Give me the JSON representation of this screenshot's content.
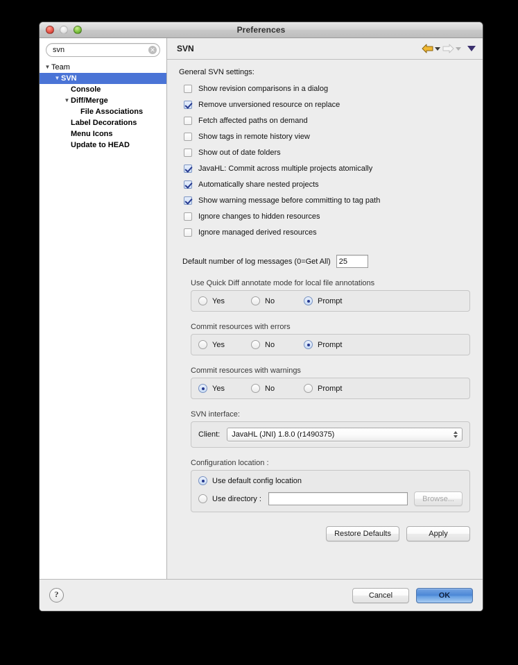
{
  "window": {
    "title": "Preferences",
    "traffic_lights": [
      "close",
      "minimize",
      "maximize"
    ]
  },
  "sidebar": {
    "search": {
      "value": "svn",
      "placeholder": "",
      "clear_glyph": "✕"
    },
    "tree": [
      {
        "label": "Team",
        "depth": 0,
        "twisty": "▼",
        "selected": false
      },
      {
        "label": "SVN",
        "depth": 1,
        "twisty": "▼",
        "selected": true
      },
      {
        "label": "Console",
        "depth": 2,
        "twisty": "",
        "selected": false
      },
      {
        "label": "Diff/Merge",
        "depth": 2,
        "twisty": "▼",
        "selected": false
      },
      {
        "label": "File Associations",
        "depth": 3,
        "twisty": "",
        "selected": false
      },
      {
        "label": "Label Decorations",
        "depth": 2,
        "twisty": "",
        "selected": false
      },
      {
        "label": "Menu Icons",
        "depth": 2,
        "twisty": "",
        "selected": false
      },
      {
        "label": "Update to HEAD",
        "depth": 2,
        "twisty": "",
        "selected": false
      }
    ]
  },
  "page": {
    "title": "SVN",
    "nav": {
      "back_enabled": true,
      "forward_enabled": false,
      "menu_glyph": "▼"
    },
    "section_label": "General SVN settings:",
    "checkboxes": [
      {
        "label": "Show revision comparisons in a dialog",
        "checked": false
      },
      {
        "label": "Remove unversioned resource on replace",
        "checked": true
      },
      {
        "label": "Fetch affected paths on demand",
        "checked": false
      },
      {
        "label": "Show tags in remote history view",
        "checked": false
      },
      {
        "label": "Show out of date folders",
        "checked": false
      },
      {
        "label": "JavaHL: Commit across multiple projects atomically",
        "checked": true
      },
      {
        "label": "Automatically share nested projects",
        "checked": true
      },
      {
        "label": "Show warning message before committing to tag path",
        "checked": true
      },
      {
        "label": "Ignore changes to hidden resources",
        "checked": false
      },
      {
        "label": "Ignore managed derived resources",
        "checked": false
      }
    ],
    "log_messages": {
      "label": "Default number of log messages (0=Get All)",
      "value": "25"
    },
    "radio_groups": [
      {
        "title": "Use Quick Diff annotate mode for local file annotations",
        "options": [
          "Yes",
          "No",
          "Prompt"
        ],
        "selected": "Prompt"
      },
      {
        "title": "Commit resources with errors",
        "options": [
          "Yes",
          "No",
          "Prompt"
        ],
        "selected": "Prompt"
      },
      {
        "title": "Commit resources with warnings",
        "options": [
          "Yes",
          "No",
          "Prompt"
        ],
        "selected": "Yes"
      }
    ],
    "svn_interface": {
      "title": "SVN interface:",
      "client_label": "Client:",
      "client_value": "JavaHL (JNI) 1.8.0 (r1490375)"
    },
    "config_location": {
      "title": "Configuration location :",
      "default_option": "Use default config location",
      "default_selected": true,
      "directory_option": "Use directory :",
      "directory_selected": false,
      "directory_value": "",
      "browse_label": "Browse...",
      "browse_enabled": false
    },
    "actions": {
      "restore_defaults": "Restore Defaults",
      "apply": "Apply"
    }
  },
  "footer": {
    "help_glyph": "?",
    "cancel": "Cancel",
    "ok": "OK"
  },
  "colors": {
    "selection_blue": "#4a74d6",
    "control_accent": "#26398f",
    "default_button": "#4b86d6",
    "window_bg": "#ededed"
  }
}
